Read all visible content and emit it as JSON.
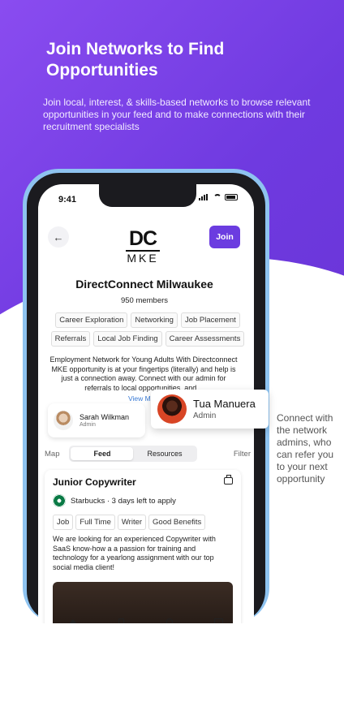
{
  "promo": {
    "headline": "Join Networks to Find Opportunities",
    "subtext": "Join local, interest, & skills-based networks to browse relevant opportunities in your feed and to make connections with their recruitment specialists",
    "side_note": "Connect with the network admins, who can refer you to your next opportunity"
  },
  "status_bar": {
    "time": "9:41"
  },
  "network": {
    "back_icon": "arrow-left-icon",
    "join_label": "Join",
    "logo_top": "DC",
    "logo_bottom": "MKE",
    "name": "DirectConnect Milwaukee",
    "members": "950 members",
    "tags": [
      "Career Exploration",
      "Networking",
      "Job Placement",
      "Referrals",
      "Local Job Finding",
      "Career Assessments"
    ],
    "description": "Employment Network for Young Adults With Directconnect MKE opportunity is at your fingertips (literally) and help is just a connection away. Connect with our admin for referrals to local opportunities, and...",
    "view_more": "View More"
  },
  "admins": [
    {
      "name": "Sarah Wilkman",
      "role": "Admin"
    },
    {
      "name": "Tua Manuera",
      "role": "Admin"
    }
  ],
  "tabs": {
    "map": "Map",
    "feed": "Feed",
    "resources": "Resources",
    "filter": "Filter"
  },
  "job": {
    "title": "Junior Copywriter",
    "company_line": "Starbucks · 3 days left to apply",
    "tags": [
      "Job",
      "Full Time",
      "Writer",
      "Good Benefits"
    ],
    "description": "We are looking for an experienced Copywriter with SaaS know-how a a passion for training and technology for a yearlong assignment with our top social media client!"
  },
  "bottom_nav": [
    "home-icon",
    "document-icon",
    "bell-icon",
    "mail-icon"
  ],
  "colors": {
    "accent": "#6b3ce0",
    "gradient_start": "#8a4cf0",
    "link": "#3a7bd5"
  }
}
